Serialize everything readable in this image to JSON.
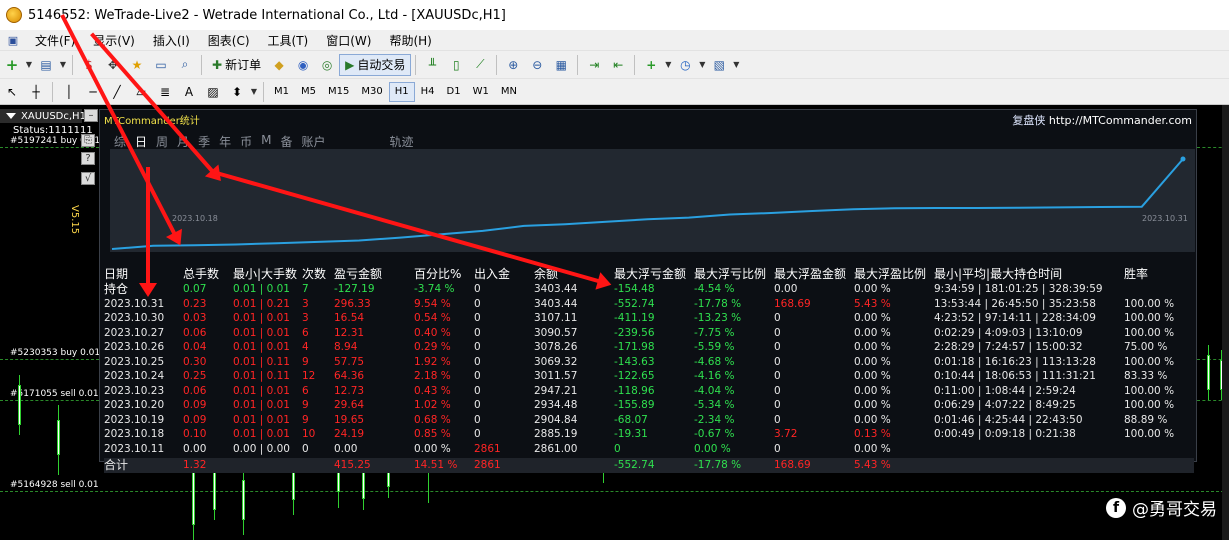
{
  "window": {
    "title": "5146552: WeTrade-Live2 - Wetrade International Co., Ltd - [XAUUSDc,H1]"
  },
  "menu": [
    "文件(F)",
    "显示(V)",
    "插入(I)",
    "图表(C)",
    "工具(T)",
    "窗口(W)",
    "帮助(H)"
  ],
  "toolbar": {
    "new_order": "新订单",
    "auto_trading": "自动交易"
  },
  "timeframes": [
    "M1",
    "M5",
    "M15",
    "M30",
    "H1",
    "H4",
    "D1",
    "W1",
    "MN"
  ],
  "active_timeframe": "H1",
  "chart": {
    "title": "XAUUSDc,H1",
    "status": "Status:1111111",
    "version": "V5.15",
    "order_labels": [
      "#5197241 buy 0.01",
      "#5230353 buy 0.01",
      "#5171055 sell 0.01",
      "#5164928 sell 0.01"
    ]
  },
  "panel": {
    "brand": "MTCommander统计",
    "site_name": "复盘侠",
    "site_url": "http://MTCommander.com",
    "tabs": [
      "综",
      "日",
      "周",
      "月",
      "季",
      "年",
      "币",
      "M",
      "备",
      "账户",
      "轨迹"
    ],
    "active_tab": "日",
    "equity_start_date": "2023.10.18",
    "equity_end_date": "2023.10.31",
    "equity_curve": [
      2861,
      2880,
      2884,
      2888,
      2896,
      2904,
      2912,
      2930,
      2950,
      2970,
      3000,
      3010,
      3025,
      3040,
      3050,
      3069,
      3078,
      3090,
      3100,
      3107,
      3108,
      3108,
      3110,
      3112,
      3114,
      3116,
      3403.44
    ],
    "headers": [
      "日期",
      "总手数",
      "最小|大手数",
      "次数",
      "盈亏金额",
      "百分比%",
      "出入金",
      "余额",
      "最大浮亏金额",
      "最大浮亏比例",
      "最大浮盈金额",
      "最大浮盈比例",
      "最小|平均|最大持仓时间",
      "胜率"
    ],
    "holding": {
      "label": "持仓",
      "lots": "0.07",
      "minmax": "0.01 | 0.01",
      "count": "7",
      "pnl": "-127.19",
      "pct": "-3.74 %",
      "deposit": "0",
      "balance": "3403.44",
      "max_dd": "-154.48",
      "max_dd_pct": "-4.54 %",
      "max_fp": "0.00",
      "max_fp_pct": "0.00 %",
      "hold_time": "9:34:59 | 181:01:25 | 328:39:59",
      "win": ""
    },
    "rows": [
      {
        "date": "2023.10.31",
        "lots": "0.23",
        "minmax": "0.01 | 0.21",
        "count": "3",
        "pnl": "296.33",
        "pct": "9.54 %",
        "deposit": "0",
        "balance": "3403.44",
        "max_dd": "-552.74",
        "max_dd_pct": "-17.78 %",
        "max_fp": "168.69",
        "max_fp_pct": "5.43 %",
        "hold_time": "13:53:44 | 26:45:50 | 35:23:58",
        "win": "100.00 %",
        "fp_red": true
      },
      {
        "date": "2023.10.30",
        "lots": "0.03",
        "minmax": "0.01 | 0.01",
        "count": "3",
        "pnl": "16.54",
        "pct": "0.54 %",
        "deposit": "0",
        "balance": "3107.11",
        "max_dd": "-411.19",
        "max_dd_pct": "-13.23 %",
        "max_fp": "0",
        "max_fp_pct": "0.00 %",
        "hold_time": "4:23:52 | 97:14:11 | 228:34:09",
        "win": "100.00 %"
      },
      {
        "date": "2023.10.27",
        "lots": "0.06",
        "minmax": "0.01 | 0.01",
        "count": "6",
        "pnl": "12.31",
        "pct": "0.40 %",
        "deposit": "0",
        "balance": "3090.57",
        "max_dd": "-239.56",
        "max_dd_pct": "-7.75 %",
        "max_fp": "0",
        "max_fp_pct": "0.00 %",
        "hold_time": "0:02:29 | 4:09:03 | 13:10:09",
        "win": "100.00 %"
      },
      {
        "date": "2023.10.26",
        "lots": "0.04",
        "minmax": "0.01 | 0.01",
        "count": "4",
        "pnl": "8.94",
        "pct": "0.29 %",
        "deposit": "0",
        "balance": "3078.26",
        "max_dd": "-171.98",
        "max_dd_pct": "-5.59 %",
        "max_fp": "0",
        "max_fp_pct": "0.00 %",
        "hold_time": "2:28:29 | 7:24:57 | 15:00:32",
        "win": "75.00 %"
      },
      {
        "date": "2023.10.25",
        "lots": "0.30",
        "minmax": "0.01 | 0.11",
        "count": "9",
        "pnl": "57.75",
        "pct": "1.92 %",
        "deposit": "0",
        "balance": "3069.32",
        "max_dd": "-143.63",
        "max_dd_pct": "-4.68 %",
        "max_fp": "0",
        "max_fp_pct": "0.00 %",
        "hold_time": "0:01:18 | 16:16:23 | 113:13:28",
        "win": "100.00 %"
      },
      {
        "date": "2023.10.24",
        "lots": "0.25",
        "minmax": "0.01 | 0.11",
        "count": "12",
        "pnl": "64.36",
        "pct": "2.18 %",
        "deposit": "0",
        "balance": "3011.57",
        "max_dd": "-122.65",
        "max_dd_pct": "-4.16 %",
        "max_fp": "0",
        "max_fp_pct": "0.00 %",
        "hold_time": "0:10:44 | 18:06:53 | 111:31:21",
        "win": "83.33 %"
      },
      {
        "date": "2023.10.23",
        "lots": "0.06",
        "minmax": "0.01 | 0.01",
        "count": "6",
        "pnl": "12.73",
        "pct": "0.43 %",
        "deposit": "0",
        "balance": "2947.21",
        "max_dd": "-118.96",
        "max_dd_pct": "-4.04 %",
        "max_fp": "0",
        "max_fp_pct": "0.00 %",
        "hold_time": "0:11:00 | 1:08:44 | 2:59:24",
        "win": "100.00 %"
      },
      {
        "date": "2023.10.20",
        "lots": "0.09",
        "minmax": "0.01 | 0.01",
        "count": "9",
        "pnl": "29.64",
        "pct": "1.02 %",
        "deposit": "0",
        "balance": "2934.48",
        "max_dd": "-155.89",
        "max_dd_pct": "-5.34 %",
        "max_fp": "0",
        "max_fp_pct": "0.00 %",
        "hold_time": "0:06:29 | 4:07:22 | 8:49:25",
        "win": "100.00 %"
      },
      {
        "date": "2023.10.19",
        "lots": "0.09",
        "minmax": "0.01 | 0.01",
        "count": "9",
        "pnl": "19.65",
        "pct": "0.68 %",
        "deposit": "0",
        "balance": "2904.84",
        "max_dd": "-68.07",
        "max_dd_pct": "-2.34 %",
        "max_fp": "0",
        "max_fp_pct": "0.00 %",
        "hold_time": "0:01:46 | 4:25:44 | 22:43:50",
        "win": "88.89 %"
      },
      {
        "date": "2023.10.18",
        "lots": "0.10",
        "minmax": "0.01 | 0.01",
        "count": "10",
        "pnl": "24.19",
        "pct": "0.85 %",
        "deposit": "0",
        "balance": "2885.19",
        "max_dd": "-19.31",
        "max_dd_pct": "-0.67 %",
        "max_fp": "3.72",
        "max_fp_pct": "0.13 %",
        "hold_time": "0:00:49 | 0:09:18 | 0:21:38",
        "win": "100.00 %",
        "fp_red": true
      },
      {
        "date": "2023.10.11",
        "lots": "0.00",
        "minmax": "0.00 | 0.00",
        "count": "0",
        "pnl": "0.00",
        "pct": "0.00 %",
        "deposit": "2861",
        "balance": "2861.00",
        "max_dd": "0",
        "max_dd_pct": "0.00 %",
        "max_fp": "0",
        "max_fp_pct": "0.00 %",
        "hold_time": "",
        "win": "",
        "zero": true
      }
    ],
    "total": {
      "label": "合计",
      "lots": "1.32",
      "pnl": "415.25",
      "pct": "14.51 %",
      "deposit": "2861",
      "max_dd": "-552.74",
      "max_dd_pct": "-17.78 %",
      "max_fp": "168.69",
      "max_fp_pct": "5.43 %"
    }
  },
  "watermark": "@勇哥交易",
  "colors": {
    "profit": "#ff2525",
    "loss": "#2fe04f",
    "curve": "#2aa0e0",
    "panel_bg": "#0c0f14"
  }
}
